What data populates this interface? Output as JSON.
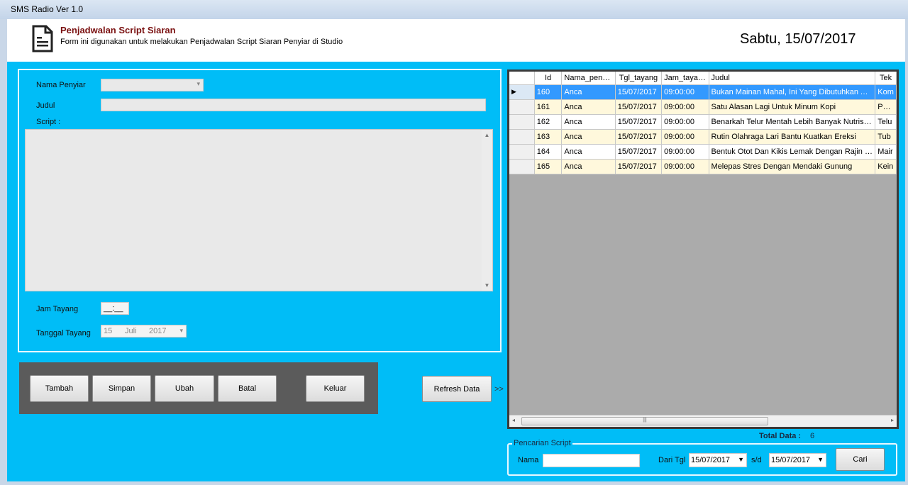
{
  "window": {
    "title": "SMS Radio Ver 1.0"
  },
  "header": {
    "icon": "document-icon",
    "title": "Penjadwalan Script Siaran",
    "subtitle": "Form ini digunakan untuk melakukan Penjadwalan Script Siaran Penyiar di Studio",
    "date": "Sabtu, 15/07/2017"
  },
  "form": {
    "nama_label": "Nama Penyiar",
    "nama_value": "",
    "judul_label": "Judul",
    "judul_value": "",
    "script_label": "Script :",
    "script_value": "",
    "jam_label": "Jam Tayang",
    "jam_value": "__:__",
    "tanggal_label": "Tanggal Tayang",
    "tanggal_day": "15",
    "tanggal_month": "Juli",
    "tanggal_year": "2017"
  },
  "buttons": {
    "tambah": "Tambah",
    "simpan": "Simpan",
    "ubah": "Ubah",
    "batal": "Batal",
    "keluar": "Keluar",
    "refresh": "Refresh Data",
    "arrow": ">>"
  },
  "grid": {
    "columns": [
      "Id",
      "Nama_penyiar",
      "Tgl_tayang",
      "Jam_tayang",
      "Judul",
      "Tek"
    ],
    "rows": [
      [
        "160",
        "Anca",
        "15/07/2017",
        "09:00:00",
        "Bukan Mainan Mahal, Ini Yang Dibutuhkan Anak...",
        "Kom"
      ],
      [
        "161",
        "Anca",
        "15/07/2017",
        "09:00:00",
        "Satu Alasan Lagi Untuk Minum Kopi",
        "Para"
      ],
      [
        "162",
        "Anca",
        "15/07/2017",
        "09:00:00",
        "Benarkah Telur Mentah Lebih Banyak Nutrisinya?",
        "Telu"
      ],
      [
        "163",
        "Anca",
        "15/07/2017",
        "09:00:00",
        "Rutin Olahraga Lari Bantu Kuatkan Ereksi",
        "Tub"
      ],
      [
        "164",
        "Anca",
        "15/07/2017",
        "09:00:00",
        "Bentuk Otot Dan Kikis Lemak Dengan Rajin Lom...",
        "Mair"
      ],
      [
        "165",
        "Anca",
        "15/07/2017",
        "09:00:00",
        "Melepas Stres Dengan Mendaki Gunung",
        "Kein"
      ]
    ],
    "selected_row": 0,
    "colors": {
      "selected": "#3399ff",
      "alt": "#fff8dc"
    }
  },
  "total": {
    "label": "Total Data :",
    "value": "6"
  },
  "search": {
    "group_label": "Pencarian Script",
    "nama_label": "Nama",
    "nama_value": "",
    "dari_label": "Dari Tgl",
    "dari_value": "15/07/2017",
    "sd_label": "s/d",
    "sd_value": "15/07/2017",
    "cari": "Cari"
  }
}
